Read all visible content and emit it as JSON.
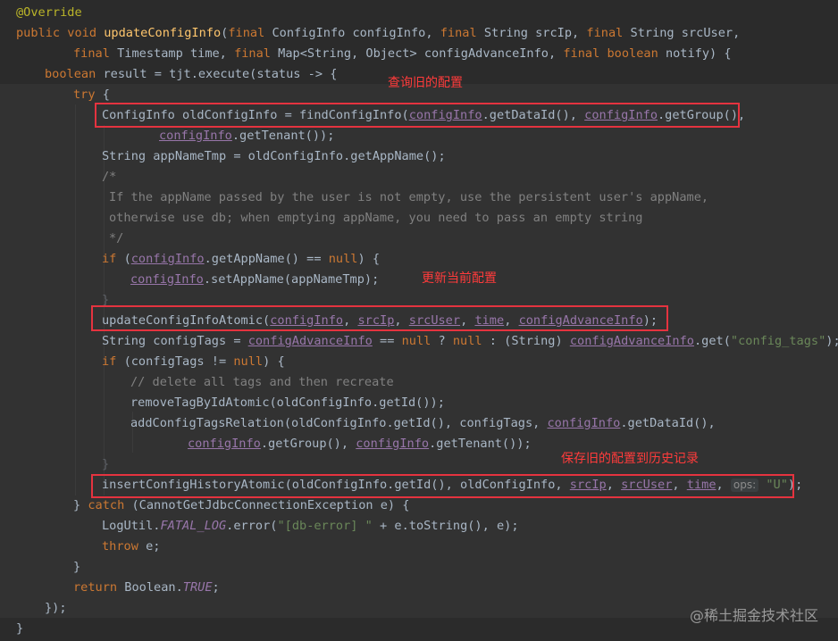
{
  "editor": {
    "lines": [
      "@Override",
      "public void updateConfigInfo(final ConfigInfo configInfo, final String srcIp, final String srcUser,",
      "final Timestamp time, final Map<String, Object> configAdvanceInfo, final boolean notify) {",
      "boolean result = tjt.execute(status -> {",
      "try {",
      "ConfigInfo oldConfigInfo = findConfigInfo(configInfo.getDataId(), configInfo.getGroup(),",
      "configInfo.getTenant());",
      "String appNameTmp = oldConfigInfo.getAppName();",
      "/*",
      "If the appName passed by the user is not empty, use the persistent user's appName,",
      "otherwise use db; when emptying appName, you need to pass an empty string",
      "*/",
      "if (configInfo.getAppName() == null) {",
      "configInfo.setAppName(appNameTmp);",
      "}",
      "updateConfigInfoAtomic(configInfo, srcIp, srcUser, time, configAdvanceInfo);",
      "String configTags = configAdvanceInfo == null ? null : (String) configAdvanceInfo.get(\"config_tags\");",
      "if (configTags != null) {",
      "// delete all tags and then recreate",
      "removeTagByIdAtomic(oldConfigInfo.getId());",
      "addConfigTagsRelation(oldConfigInfo.getId(), configTags, configInfo.getDataId(),",
      "configInfo.getGroup(), configInfo.getTenant());",
      "}",
      "insertConfigHistoryAtomic(oldConfigInfo.getId(), oldConfigInfo, srcIp, srcUser, time, ops: \"U\");",
      "} catch (CannotGetJdbcConnectionException e) {",
      "LogUtil.FATAL_LOG.error(\"[db-error] \" + e.toString(), e);",
      "throw e;",
      "}",
      "return Boolean.TRUE;",
      "});",
      "}"
    ],
    "inlay_hint": "ops:"
  },
  "annotations": {
    "query_old_config": "查询旧的配置",
    "update_current_config": "更新当前配置",
    "save_old_to_history": "保存旧的配置到历史记录"
  },
  "watermark": "@稀土掘金技术社区",
  "colors": {
    "background": "#2b2b2b",
    "keyword": "#cc7832",
    "method": "#ffc66d",
    "field": "#9876aa",
    "comment": "#808080",
    "string": "#6a8759",
    "annotation_box": "#e5333f"
  }
}
